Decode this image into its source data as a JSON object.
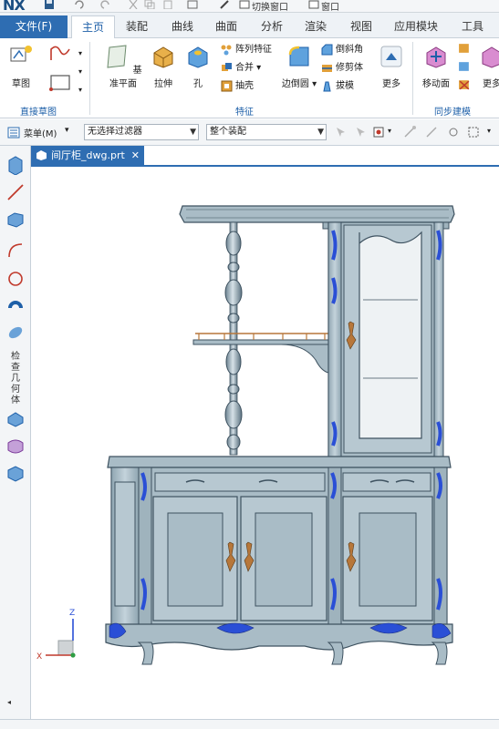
{
  "app": {
    "logo": "NX"
  },
  "quick_access": {
    "switch_window": "切换窗口",
    "window": "窗口"
  },
  "menu": {
    "file": "文件(F)",
    "tabs": [
      "主页",
      "装配",
      "曲线",
      "曲面",
      "分析",
      "渲染",
      "视图",
      "应用模块",
      "工具"
    ],
    "active_tab": "主页"
  },
  "ribbon": {
    "direct_sketch": {
      "sketch": "草图",
      "group_label": "直接草图"
    },
    "feature": {
      "datum_plane": "基准平面",
      "extrude": "拉伸",
      "hole": "孔",
      "pattern_feature": "阵列特征",
      "unite": "合并",
      "shell": "抽壳",
      "edge_blend": "边倒圆",
      "chamfer": "倒斜角",
      "trim_body": "修剪体",
      "draft": "拔模",
      "more": "更多",
      "group_label": "特征"
    },
    "sync_modeling": {
      "move_face": "移动面",
      "more": "更多",
      "group_label": "同步建模"
    }
  },
  "filterbar": {
    "menu": "菜单(M)",
    "filter": "无选择过滤器",
    "scope": "整个装配"
  },
  "sidebar": {
    "label": "检查几何体"
  },
  "document": {
    "tab": "间厅柜_dwg.prt"
  },
  "viewport": {
    "triad": {
      "x": "X",
      "z": "Z"
    }
  },
  "colors": {
    "accent": "#2e6db2",
    "cabinet": "#a9bcc6",
    "cabinet_dark": "#3e5260",
    "ornament": "#2a4fd6",
    "brass": "#b7773a"
  }
}
